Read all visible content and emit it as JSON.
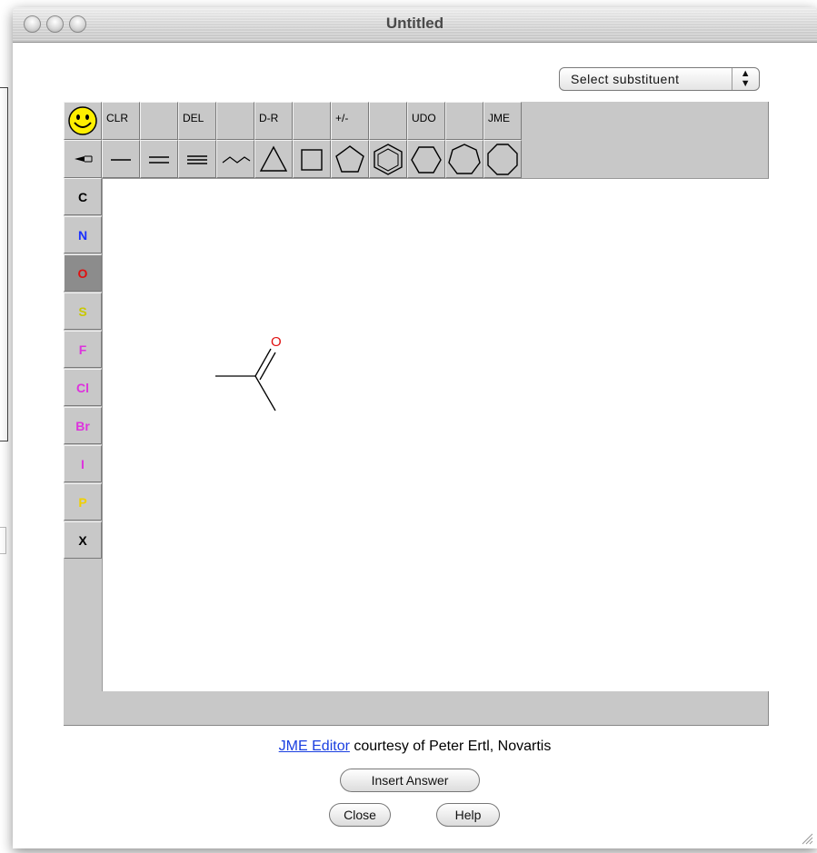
{
  "window": {
    "title": "Untitled"
  },
  "substituent_select": {
    "selected": "Select substituent",
    "arrows": "▲▼"
  },
  "toolbar": {
    "row1": [
      "CLR",
      "",
      "DEL",
      "",
      "D-R",
      "",
      "+/-",
      "",
      "UDO",
      "",
      "JME"
    ],
    "row2_icons": [
      "chain-icon",
      "single-bond-icon",
      "double-bond-icon",
      "triple-bond-icon",
      "wavy-chain-icon",
      "triangle-ring-icon",
      "square-ring-icon",
      "pentagon-ring-icon",
      "benzene-ring-icon",
      "hexagon-ring-icon",
      "heptagon-ring-icon",
      "octagon-ring-icon"
    ]
  },
  "elements": [
    {
      "symbol": "C",
      "color": "#000000"
    },
    {
      "symbol": "N",
      "color": "#1a30ff"
    },
    {
      "symbol": "O",
      "color": "#e01010",
      "active": true
    },
    {
      "symbol": "S",
      "color": "#c8c800"
    },
    {
      "symbol": "F",
      "color": "#dd33dd"
    },
    {
      "symbol": "Cl",
      "color": "#dd33dd"
    },
    {
      "symbol": "Br",
      "color": "#dd33dd"
    },
    {
      "symbol": "I",
      "color": "#dd33dd"
    },
    {
      "symbol": "P",
      "color": "#f0d000"
    },
    {
      "symbol": "X",
      "color": "#000000"
    }
  ],
  "molecule": {
    "atom_label": "O",
    "atom_color": "#e01010"
  },
  "footer": {
    "link": "JME Editor",
    "credit": " courtesy of Peter Ertl, Novartis",
    "insert_label": "Insert Answer",
    "close_label": "Close",
    "help_label": "Help"
  }
}
